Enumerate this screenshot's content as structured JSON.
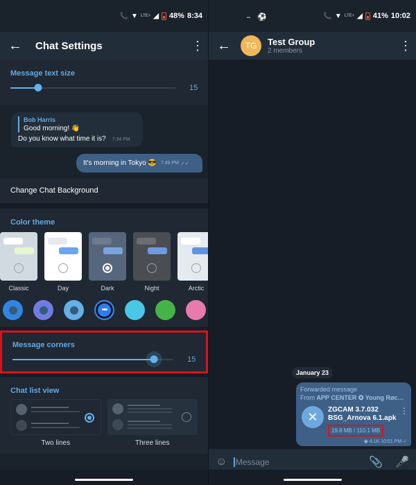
{
  "left": {
    "status": {
      "battery": "48%",
      "time": "8:34",
      "lte_small": "LTE+",
      "call_lte": "LTE"
    },
    "appbar": {
      "title": "Chat Settings",
      "back_icon": "arrow-left-icon",
      "more_icon": "more-vert-icon"
    },
    "text_size": {
      "label": "Message text size",
      "value": "15",
      "fraction": 0.17
    },
    "preview": {
      "reply_name": "Bob Harris",
      "reply_text": "Good morning! 👋",
      "incoming_text": "Do you know what time it is?",
      "incoming_time": "7:34 PM",
      "outgoing_text": "It's morning in Tokyo 😎",
      "outgoing_time": "7:49 PM",
      "read_icon": "double-check-icon"
    },
    "change_background": "Change Chat Background",
    "color_theme": {
      "label": "Color theme",
      "themes": [
        {
          "name": "Classic",
          "bg": "#d1d9e1",
          "b1": "#ffffff",
          "b2": "#e6f7d2",
          "selected": false
        },
        {
          "name": "Day",
          "bg": "#ffffff",
          "b1": "#e6e9ef",
          "b2": "#6aa5f0",
          "selected": false
        },
        {
          "name": "Dark",
          "bg": "#56667d",
          "b1": "#6d7b8f",
          "b2": "#7aa2dd",
          "selected": true
        },
        {
          "name": "Night",
          "bg": "#4a4d52",
          "b1": "#6a6d72",
          "b2": "#6d9ae0",
          "selected": false
        },
        {
          "name": "Arctic",
          "bg": "#e5eaf0",
          "b1": "#ffffff",
          "b2": "#5f95e0",
          "selected": false
        }
      ],
      "accents": [
        "#2f86e0",
        "#6f7ce0",
        "#64b0e8",
        "#2f7cf0",
        "#4ac6e6",
        "#46b348",
        "#e87aae"
      ],
      "selected_accent_index": 3,
      "more_glyph": "•••"
    },
    "corners": {
      "label": "Message corners",
      "value": "15",
      "fraction": 0.88
    },
    "chat_list": {
      "label": "Chat list view",
      "options": [
        {
          "label": "Two lines",
          "selected": true
        },
        {
          "label": "Three lines",
          "selected": false
        }
      ]
    }
  },
  "right": {
    "status": {
      "battery": "41%",
      "time": "10:02",
      "lte_small": "LTE+",
      "call_lte": "LTE"
    },
    "header": {
      "avatar": "TG",
      "avatar_color": "#f0b75a",
      "name": "Test Group",
      "subtitle": "2 members"
    },
    "date_chip": "January 23",
    "message": {
      "forwarded_label": "Forwarded message",
      "from_prefix": "From ",
      "from_name": "APP CENTER ✪ Young Røc…",
      "file_name_1": "ZGCAM 3.7.032",
      "file_name_2": "BSG_Arnova 6.1.apk",
      "file_size": "19.8 MB / 110.1 MB",
      "views": "4.1K",
      "time": "10:01 PM"
    },
    "input": {
      "placeholder": "Message"
    }
  }
}
